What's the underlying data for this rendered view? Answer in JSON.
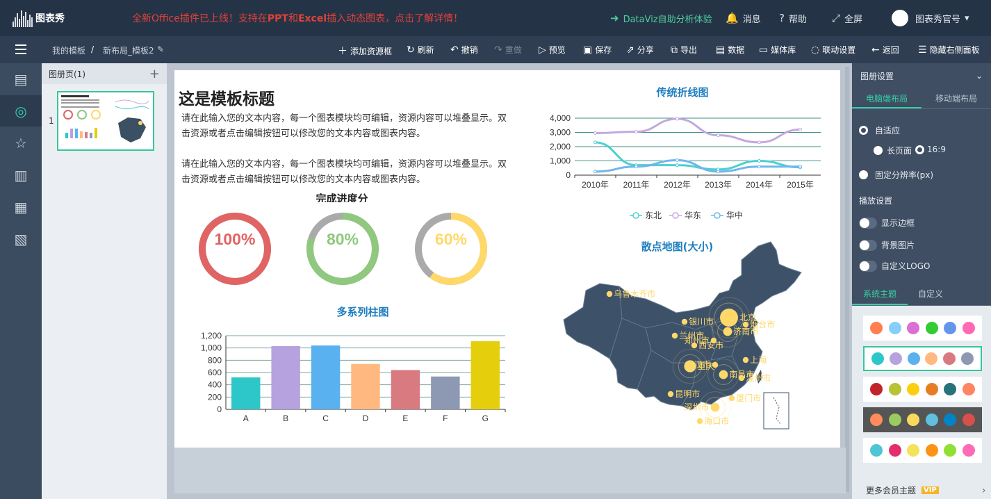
{
  "topbar": {
    "logo_text": "图表秀",
    "announcement_prefix": "全新Office插件已上线！支持在",
    "announcement_ppt": "PPT",
    "announcement_mid": "和",
    "announcement_excel": "Excel",
    "announcement_suffix": "插入动态图表，点击了解详情！",
    "dataviz": "DataViz自助分析体验",
    "messages": "消息",
    "help": "帮助",
    "fullscreen": "全屏",
    "account": "图表秀官号"
  },
  "toolbar": {
    "crumb_home": "我的模板",
    "crumb_sep": "/",
    "crumb_current": "新布局_模板2",
    "add_resource": "添加资源框",
    "refresh": "刷新",
    "undo": "撤销",
    "redo": "重做",
    "preview": "预览",
    "save": "保存",
    "share": "分享",
    "export": "导出",
    "data": "数据",
    "media": "媒体库",
    "link": "联动设置",
    "back": "返回",
    "hide_right": "隐藏右侧面板"
  },
  "pages": {
    "header": "图册页(1)",
    "add": "+",
    "items": [
      {
        "num": "1"
      }
    ]
  },
  "slide": {
    "title": "这是模板标题",
    "para1": "请在此输入您的文本内容，每一个图表模块均可编辑，资源内容可以堆叠显示。双击资源或者点击编辑按钮可以修改您的文本内容或图表内容。",
    "para2": "请在此输入您的文本内容，每一个图表模块均可编辑，资源内容可以堆叠显示。双击资源或者点击编辑按钮可以修改您的文本内容或图表内容。",
    "progress_title": "完成进度分",
    "line_title": "传统折线图",
    "bar_title": "多系列柱图",
    "map_title": "散点地图(大小)"
  },
  "chart_data": [
    {
      "type": "pie",
      "title": "完成进度分",
      "rings": [
        {
          "value": 100,
          "label": "100%",
          "color": "#e06464"
        },
        {
          "value": 80,
          "label": "80%",
          "color": "#8fc87e"
        },
        {
          "value": 60,
          "label": "60%",
          "color": "#ffd86a"
        }
      ],
      "track_color": "#aaaaaa"
    },
    {
      "type": "line",
      "title": "传统折线图",
      "categories": [
        "2010年",
        "2011年",
        "2012年",
        "2013年",
        "2014年",
        "2015年"
      ],
      "ylim": [
        0,
        4000
      ],
      "yticks": [
        "4,000",
        "3,000",
        "2,000",
        "1,000",
        "0"
      ],
      "series": [
        {
          "name": "东北",
          "color": "#4ecfd0",
          "values": [
            2300,
            700,
            700,
            400,
            1000,
            550
          ]
        },
        {
          "name": "华东",
          "color": "#c3a8e0",
          "values": [
            2950,
            3050,
            3950,
            2800,
            2300,
            3200
          ]
        },
        {
          "name": "华中",
          "color": "#6fb7ea",
          "values": [
            250,
            600,
            1050,
            250,
            600,
            600
          ]
        }
      ],
      "legend": "bottom-center"
    },
    {
      "type": "bar",
      "title": "多系列柱图",
      "categories": [
        "A",
        "B",
        "C",
        "D",
        "E",
        "F",
        "G"
      ],
      "values": [
        520,
        1030,
        1040,
        740,
        640,
        535,
        1110
      ],
      "colors": [
        "#2ec7c9",
        "#b6a2de",
        "#5ab1ef",
        "#ffb980",
        "#d87a80",
        "#8d98b3",
        "#e5cf0d"
      ],
      "ylim": [
        0,
        1200
      ],
      "yticks": [
        "1,200",
        "1,000",
        "800",
        "600",
        "400",
        "200",
        "0"
      ]
    },
    {
      "type": "scatter",
      "title": "散点地图(大小)",
      "points": [
        {
          "name": "乌鲁木齐市",
          "size": 1
        },
        {
          "name": "银川市",
          "size": 1
        },
        {
          "name": "兰州市",
          "size": 1
        },
        {
          "name": "西安市",
          "size": 1
        },
        {
          "name": "郑州市",
          "size": 1
        },
        {
          "name": "北京",
          "size": 5
        },
        {
          "name": "济南市",
          "size": 2
        },
        {
          "name": "烟台市",
          "size": 1
        },
        {
          "name": "上海",
          "size": 1
        },
        {
          "name": "武汉市",
          "size": 1
        },
        {
          "name": "重庆",
          "size": 3
        },
        {
          "name": "南昌市",
          "size": 2
        },
        {
          "name": "温州市",
          "size": 1
        },
        {
          "name": "昆明市",
          "size": 1
        },
        {
          "name": "厦门市",
          "size": 1
        },
        {
          "name": "深圳市",
          "size": 2
        },
        {
          "name": "海口市",
          "size": 1
        }
      ]
    }
  ],
  "rightpanel": {
    "header": "图册设置",
    "tab_pc": "电脑端布局",
    "tab_mobile": "移动端布局",
    "auto_fit": "自适应",
    "long_page": "长页面",
    "ratio": "16:9",
    "fixed_res": "固定分辨率(px)",
    "play_settings": "播放设置",
    "show_border": "显示边框",
    "bg_image": "背景图片",
    "custom_logo": "自定义LOGO",
    "tab_system_theme": "系统主题",
    "tab_custom": "自定义",
    "more_themes": "更多会员主题",
    "vip": "VIP",
    "themes": [
      [
        "#ff7f50",
        "#87cefa",
        "#da70d6",
        "#32cd32",
        "#6495ed",
        "#ff69b4"
      ],
      [
        "#2ec7c9",
        "#b6a2de",
        "#5ab1ef",
        "#ffb980",
        "#d87a80",
        "#8d98b3"
      ],
      [
        "#c1232b",
        "#b5c334",
        "#fcce10",
        "#e87c25",
        "#27727b",
        "#fe8463"
      ],
      [
        "#ff8c5a",
        "#9bca63",
        "#fad860",
        "#60c0dd",
        "#0084c6",
        "#d7504b"
      ],
      [
        "#4ec5d6",
        "#e62d6c",
        "#f2e35b",
        "#ff9215",
        "#8fe034",
        "#ff6bb5"
      ]
    ]
  }
}
